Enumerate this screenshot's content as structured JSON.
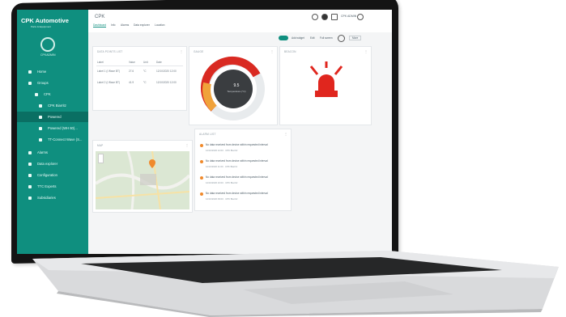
{
  "app": {
    "logo_text": "CPK Automotive",
    "logo_subtitle": "Parts & Equipment",
    "user_label": "CPKADMIN",
    "page_title": "CPK",
    "header_user": "CPK ADMIN"
  },
  "sidebar": {
    "items": [
      {
        "label": "Home"
      },
      {
        "label": "Groups"
      },
      {
        "label": "CPK"
      },
      {
        "label": "CPK Biarritz"
      },
      {
        "label": "Powered"
      },
      {
        "label": "Powered (WH 60)..."
      },
      {
        "label": "TT-Connect Wave (S..."
      },
      {
        "label": "Alarms"
      },
      {
        "label": "Data explorer"
      },
      {
        "label": "Configuration"
      },
      {
        "label": "TTC Experts"
      },
      {
        "label": "Subsidiaries"
      }
    ]
  },
  "tabs": [
    {
      "label": "Dashboard"
    },
    {
      "label": "Info"
    },
    {
      "label": "Alarms"
    },
    {
      "label": "Data explorer"
    },
    {
      "label": "Location"
    }
  ],
  "toolbar": {
    "add_widget": "Add widget",
    "edit": "Edit",
    "full_screen": "Full screen",
    "more": "More"
  },
  "cards": {
    "table": {
      "title": "DATA POINTS LIST",
      "columns": [
        "Label",
        "Value",
        "Unit",
        "Date"
      ],
      "rows": [
        {
          "label": "Label 1 (i Wave BT)",
          "value": "27.6",
          "unit": "°C",
          "date": "12/10/2020 12:00"
        },
        {
          "label": "Label 2 (i Wave BT)",
          "value": "41.9",
          "unit": "°C",
          "date": "12/10/2020 12:00"
        }
      ]
    },
    "gauge": {
      "title": "GAUGE",
      "value": "9.5",
      "unit": "Temperature (°C)",
      "level": 0.72
    },
    "beacon": {
      "title": "BEACON"
    },
    "map": {
      "title": "MAP"
    },
    "alarms": {
      "title": "ALARM LIST",
      "items": [
        {
          "text": "No data received from device within requested interval",
          "meta": "12/10/2020 12:00 · CPK Biarritz"
        },
        {
          "text": "No data received from device within requested interval",
          "meta": "12/10/2020 11:00 · CPK Biarritz"
        },
        {
          "text": "No data received from device within requested interval",
          "meta": "12/10/2020 10:00 · CPK Biarritz"
        },
        {
          "text": "No data received from device within requested interval",
          "meta": "12/10/2020 09:00 · CPK Biarritz"
        }
      ]
    }
  },
  "colors": {
    "primary": "#0f8f7f",
    "alarm": "#e0261e",
    "gauge_red": "#d92a22",
    "gauge_orange": "#f0a23a"
  }
}
